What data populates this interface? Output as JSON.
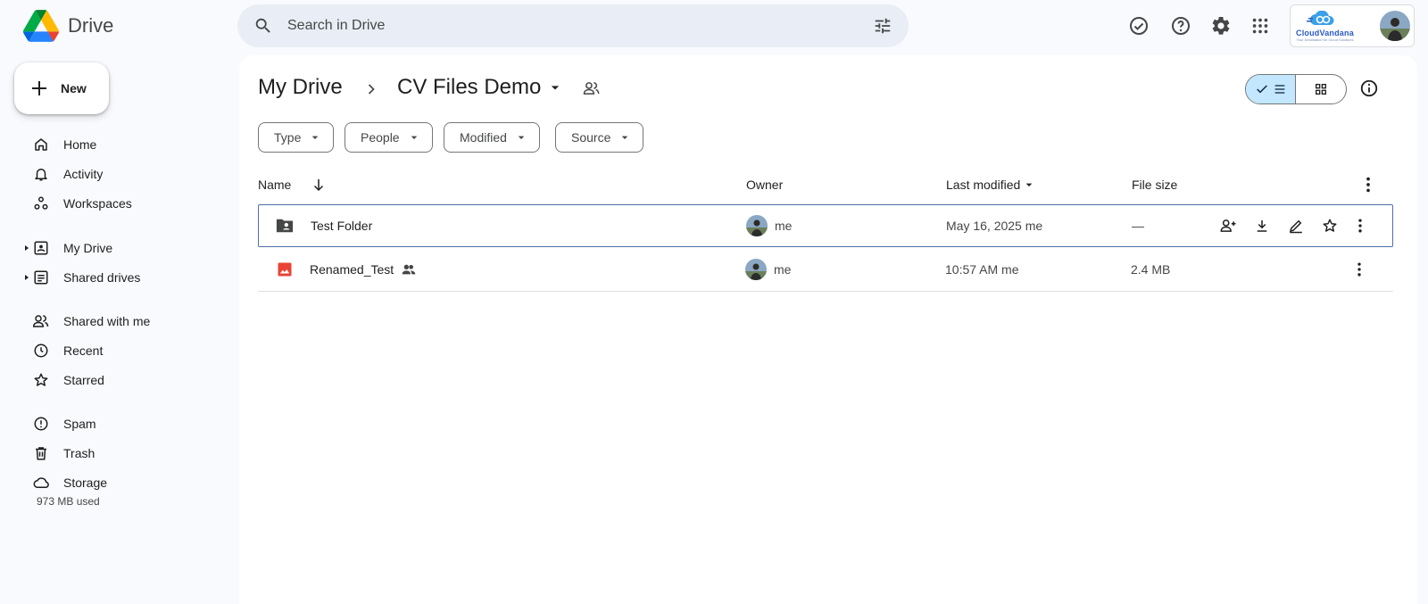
{
  "app": {
    "name": "Drive"
  },
  "search": {
    "placeholder": "Search in Drive"
  },
  "account": {
    "org_name": "CloudVandana",
    "org_tagline": "Your Destination for Cloud Solutions"
  },
  "new_button": {
    "label": "New"
  },
  "sidebar": {
    "items": [
      {
        "label": "Home",
        "icon": "home-icon"
      },
      {
        "label": "Activity",
        "icon": "bell-icon"
      },
      {
        "label": "Workspaces",
        "icon": "workspaces-icon"
      },
      {
        "label": "My Drive",
        "icon": "my-drive-icon"
      },
      {
        "label": "Shared drives",
        "icon": "shared-drives-icon"
      },
      {
        "label": "Shared with me",
        "icon": "people-icon"
      },
      {
        "label": "Recent",
        "icon": "clock-icon"
      },
      {
        "label": "Starred",
        "icon": "star-icon"
      },
      {
        "label": "Spam",
        "icon": "spam-icon"
      },
      {
        "label": "Trash",
        "icon": "trash-icon"
      },
      {
        "label": "Storage",
        "icon": "cloud-icon"
      }
    ],
    "storage_used": "973 MB used"
  },
  "breadcrumb": {
    "root": "My Drive",
    "current": "CV Files Demo"
  },
  "filters": [
    "Type",
    "People",
    "Modified",
    "Source"
  ],
  "table": {
    "headers": {
      "name": "Name",
      "owner": "Owner",
      "modified": "Last modified",
      "size": "File size"
    },
    "rows": [
      {
        "name": "Test Folder",
        "type": "shared-folder",
        "owner": "me",
        "modified": "May 16, 2025 me",
        "size": "—",
        "shared": false
      },
      {
        "name": "Renamed_Test",
        "type": "image",
        "owner": "me",
        "modified": "10:57 AM me",
        "size": "2.4 MB",
        "shared": true
      }
    ]
  },
  "colors": {
    "accent": "#0b57d0",
    "toggle_active": "#c2e7ff",
    "image_file": "#ea4335",
    "background": "#f8fafd"
  }
}
